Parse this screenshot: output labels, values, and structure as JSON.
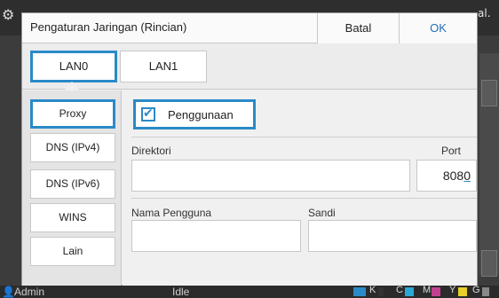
{
  "background": {
    "title_tail": "al.",
    "gear_icon": "gear-icon"
  },
  "dialog": {
    "title": "Pengaturan Jaringan (Rincian)",
    "cancel_label": "Batal",
    "ok_label": "OK"
  },
  "tabs": [
    {
      "label": "LAN0",
      "active": true
    },
    {
      "label": "LAN1",
      "active": false
    }
  ],
  "nav": [
    {
      "label": "Proxy",
      "active": true
    },
    {
      "label": "DNS (IPv4)",
      "active": false
    },
    {
      "label": "DNS (IPv6)",
      "active": false
    },
    {
      "label": "WINS",
      "active": false
    },
    {
      "label": "Lain",
      "active": false
    }
  ],
  "proxy": {
    "use_label": "Penggunaan",
    "use_checked": true,
    "directory_label": "Direktori",
    "directory_value": "",
    "port_label": "Port",
    "port_value": "808",
    "port_value_cursor": "0",
    "username_label": "Nama Pengguna",
    "username_value": "",
    "password_label": "Sandi",
    "password_value": ""
  },
  "statusbar": {
    "user": "Admin",
    "state": "Idle",
    "ink_labels": [
      "K",
      "C",
      "M",
      "Y",
      "G"
    ],
    "ink_colors": [
      "#333333",
      "#29a8d8",
      "#c2418f",
      "#e8cf2a",
      "#888888"
    ]
  },
  "colors": {
    "accent": "#2a8ac7",
    "ok_text": "#1f6fb5"
  }
}
